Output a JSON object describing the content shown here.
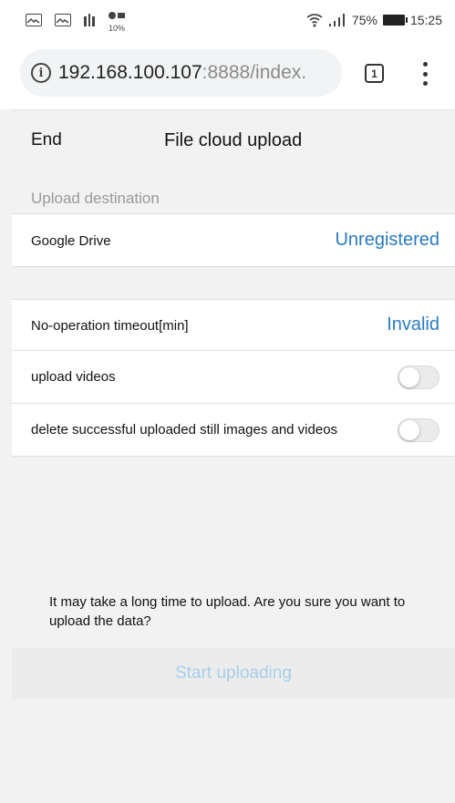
{
  "status_bar": {
    "data_label": "10%",
    "battery_percent": "75%",
    "time": "15:25",
    "icons": [
      "image-icon",
      "image-icon",
      "media-icon",
      "data-saver-icon",
      "wifi-icon",
      "signal-icon",
      "battery-icon"
    ]
  },
  "browser": {
    "url_host": "192.168.100.107",
    "url_rest": ":8888/index.",
    "tab_count": "1"
  },
  "app": {
    "end_label": "End",
    "title": "File cloud upload",
    "section_label": "Upload destination",
    "google_drive_label": "Google Drive",
    "google_drive_status": "Unregistered",
    "timeout_label": "No-operation timeout[min]",
    "timeout_value": "Invalid",
    "upload_videos_label": "upload videos",
    "upload_videos_on": false,
    "delete_label": "delete successful uploaded still images and videos",
    "delete_on": false,
    "confirm_text": "It may take a long time to upload. Are you sure you want to upload the data?",
    "start_button": "Start uploading"
  },
  "colors": {
    "accent": "#2a7bc0",
    "disabled_accent": "#a9cfe9",
    "background": "#f2f2f2"
  }
}
